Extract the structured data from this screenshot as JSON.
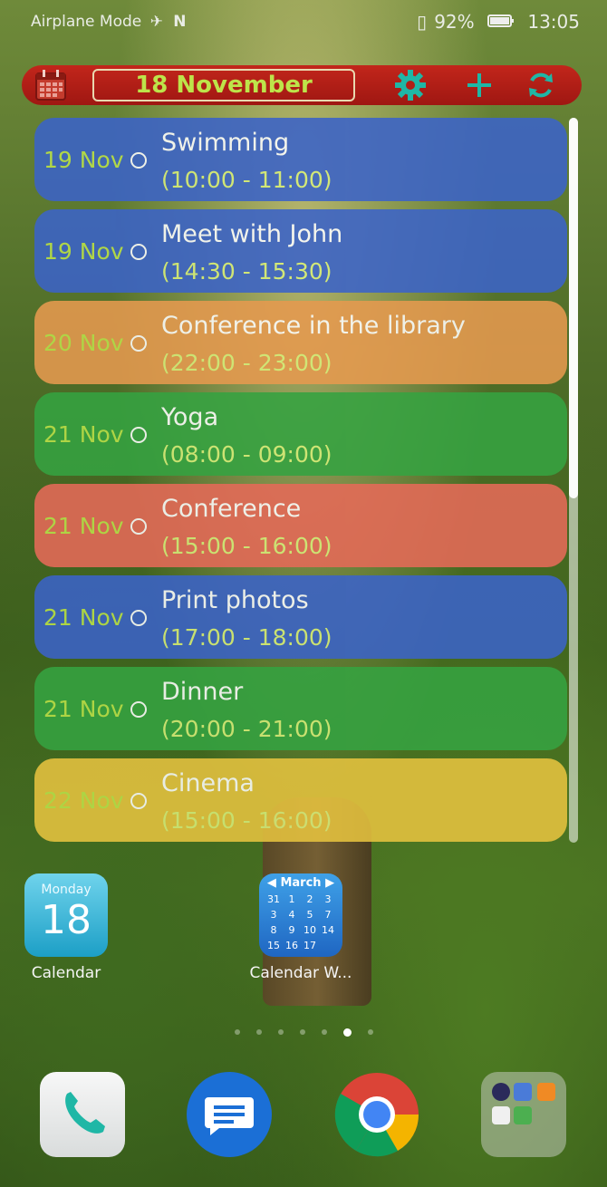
{
  "status_bar": {
    "left": "Airplane Mode",
    "battery": "92%",
    "time": "13:05"
  },
  "topbar": {
    "date": "18 November"
  },
  "events": [
    {
      "date": "19 Nov",
      "title": "Swimming",
      "time": "(10:00 - 11:00)",
      "color": "#3b63c8"
    },
    {
      "date": "19 Nov",
      "title": "Meet with John",
      "time": "(14:30 - 15:30)",
      "color": "#3b63c8"
    },
    {
      "date": "20 Nov",
      "title": "Conference in the library",
      "time": "(22:00 - 23:00)",
      "color": "#e69a4f"
    },
    {
      "date": "21 Nov",
      "title": "Yoga",
      "time": "(08:00 - 09:00)",
      "color": "#35a341"
    },
    {
      "date": "21 Nov",
      "title": "Conference",
      "time": "(15:00 - 16:00)",
      "color": "#e66a58"
    },
    {
      "date": "21 Nov",
      "title": "Print photos",
      "time": "(17:00 - 18:00)",
      "color": "#3b63c8"
    },
    {
      "date": "21 Nov",
      "title": "Dinner",
      "time": "(20:00 - 21:00)",
      "color": "#35a341"
    },
    {
      "date": "22 Nov",
      "title": "Cinema",
      "time": "(15:00 - 16:00)",
      "color": "#e6c33f"
    }
  ],
  "apps": {
    "calendar": {
      "label": "Calendar",
      "weekday": "Monday",
      "day": "18"
    },
    "calendar_widget": {
      "label": "Calendar W...",
      "month": "March",
      "days": [
        "31",
        "1",
        "2",
        "3",
        "3",
        "4",
        "5",
        "7",
        "8",
        "9",
        "10",
        "14",
        "15",
        "16",
        "17"
      ]
    }
  },
  "colors": {
    "date_text": "#bde44a",
    "time_text": "#d9f07a",
    "topbar": "#b11f16"
  }
}
